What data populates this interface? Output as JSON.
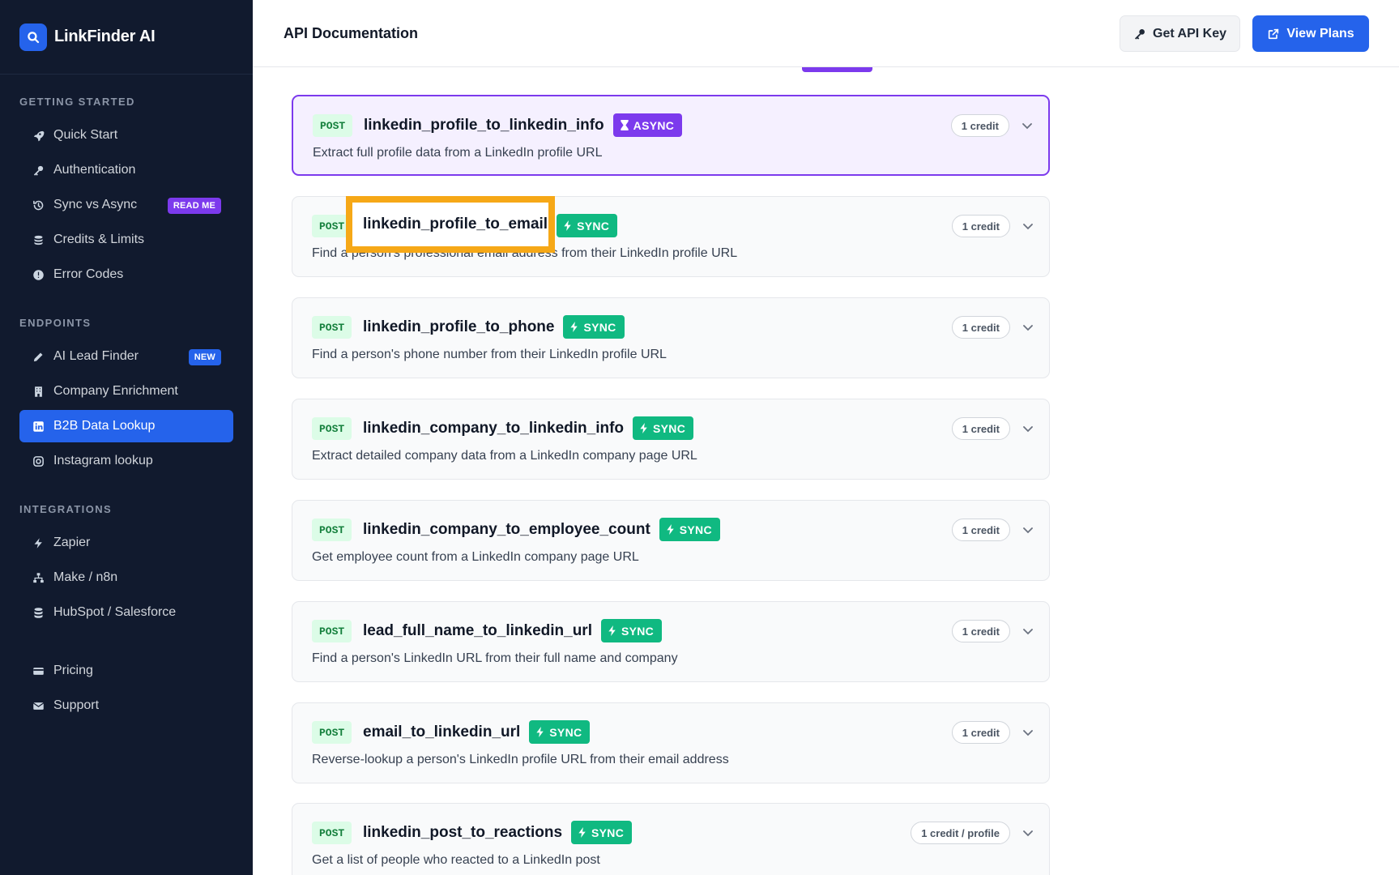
{
  "brand": {
    "name": "LinkFinder AI",
    "icon": "search-icon"
  },
  "sidebar": {
    "sections": [
      {
        "title": "GETTING STARTED",
        "items": [
          {
            "label": "Quick Start",
            "icon": "rocket-icon"
          },
          {
            "label": "Authentication",
            "icon": "key-icon"
          },
          {
            "label": "Sync vs Async",
            "icon": "history-icon",
            "badge": "READ ME"
          },
          {
            "label": "Credits & Limits",
            "icon": "coins-icon"
          },
          {
            "label": "Error Codes",
            "icon": "alert-circle-icon"
          }
        ]
      },
      {
        "title": "ENDPOINTS",
        "items": [
          {
            "label": "AI Lead Finder",
            "icon": "pencil-icon",
            "badge": "NEW"
          },
          {
            "label": "Company Enrichment",
            "icon": "building-icon"
          },
          {
            "label": "B2B Data Lookup",
            "icon": "linkedin-icon",
            "active": true
          },
          {
            "label": "Instagram lookup",
            "icon": "instagram-icon"
          }
        ]
      },
      {
        "title": "INTEGRATIONS",
        "items": [
          {
            "label": "Zapier",
            "icon": "bolt-icon"
          },
          {
            "label": "Make / n8n",
            "icon": "network-icon"
          },
          {
            "label": "HubSpot / Salesforce",
            "icon": "database-icon"
          }
        ]
      },
      {
        "title": "",
        "items": [
          {
            "label": "Pricing",
            "icon": "credit-card-icon"
          },
          {
            "label": "Support",
            "icon": "envelope-icon"
          }
        ]
      }
    ]
  },
  "header": {
    "title": "API Documentation",
    "get_key_label": "Get API Key",
    "view_plans_label": "View Plans"
  },
  "endpoints": [
    {
      "method": "POST",
      "name": "linkedin_profile_to_linkedin_info",
      "mode": "ASYNC",
      "description": "Extract full profile data from a LinkedIn profile URL",
      "credit": "1 credit",
      "selected": true
    },
    {
      "method": "POST",
      "name": "linkedin_profile_to_email",
      "mode": "SYNC",
      "description": "Find a person's professional email address from their LinkedIn profile URL",
      "credit": "1 credit"
    },
    {
      "method": "POST",
      "name": "linkedin_profile_to_phone",
      "mode": "SYNC",
      "description": "Find a person's phone number from their LinkedIn profile URL",
      "credit": "1 credit"
    },
    {
      "method": "POST",
      "name": "linkedin_company_to_linkedin_info",
      "mode": "SYNC",
      "description": "Extract detailed company data from a LinkedIn company page URL",
      "credit": "1 credit"
    },
    {
      "method": "POST",
      "name": "linkedin_company_to_employee_count",
      "mode": "SYNC",
      "description": "Get employee count from a LinkedIn company page URL",
      "credit": "1 credit"
    },
    {
      "method": "POST",
      "name": "lead_full_name_to_linkedin_url",
      "mode": "SYNC",
      "description": "Find a person's LinkedIn URL from their full name and company",
      "credit": "1 credit"
    },
    {
      "method": "POST",
      "name": "email_to_linkedin_url",
      "mode": "SYNC",
      "description": "Reverse-lookup a person's LinkedIn profile URL from their email address",
      "credit": "1 credit"
    },
    {
      "method": "POST",
      "name": "linkedin_post_to_reactions",
      "mode": "SYNC",
      "description": "Get a list of people who reacted to a LinkedIn post",
      "credit": "1 credit / profile"
    }
  ],
  "highlight": {
    "label": "linkedin_profile_to_email"
  },
  "colors": {
    "sidebar_bg": "#111a2e",
    "accent": "#2563eb",
    "async": "#7c3aed",
    "sync": "#10b981",
    "highlight": "#f6a817"
  }
}
